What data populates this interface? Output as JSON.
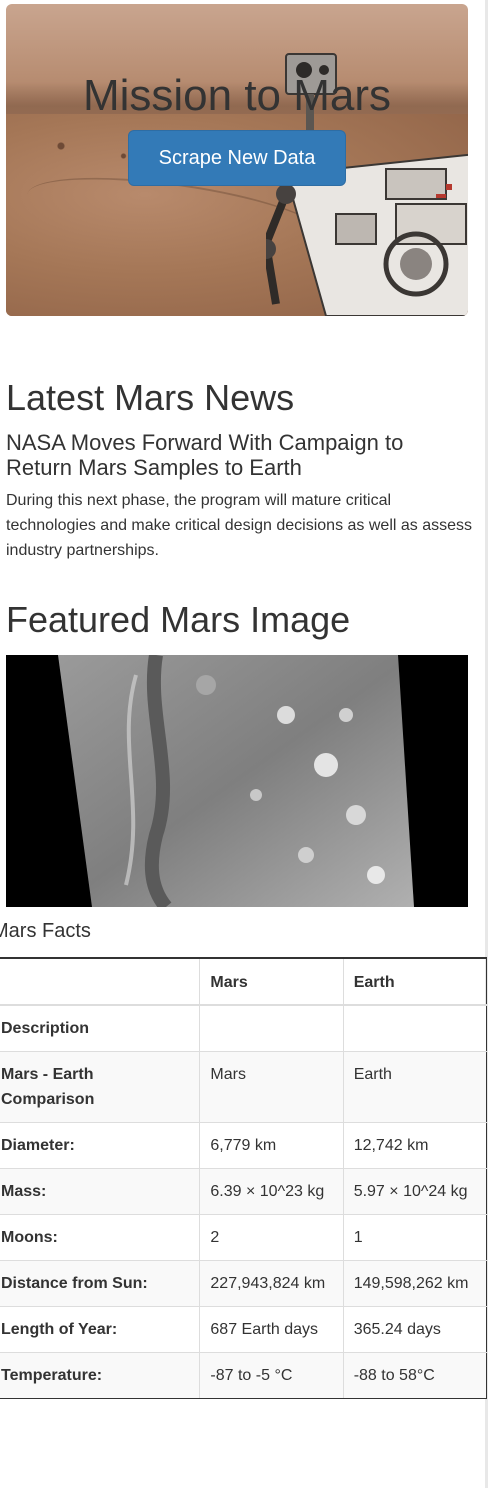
{
  "jumbotron": {
    "title": "Mission to Mars",
    "scrape_button": "Scrape New Data"
  },
  "news": {
    "heading": "Latest Mars News",
    "title": "NASA Moves Forward With Campaign to Return Mars Samples to Earth",
    "paragraph": "During this next phase, the program will mature critical technologies and make critical design decisions as well as assess industry partnerships."
  },
  "featured": {
    "heading": "Featured Mars Image"
  },
  "facts": {
    "caption": "Mars Facts",
    "headers": [
      "",
      "Mars",
      "Earth"
    ],
    "rows": [
      {
        "label": "Description",
        "mars": "",
        "earth": ""
      },
      {
        "label": "Mars - Earth Comparison",
        "mars": "Mars",
        "earth": "Earth"
      },
      {
        "label": "Diameter:",
        "mars": "6,779 km",
        "earth": "12,742 km"
      },
      {
        "label": "Mass:",
        "mars": "6.39 × 10^23 kg",
        "earth": "5.97 × 10^24 kg"
      },
      {
        "label": "Moons:",
        "mars": "2",
        "earth": "1"
      },
      {
        "label": "Distance from Sun:",
        "mars": "227,943,824 km",
        "earth": "149,598,262 km"
      },
      {
        "label": "Length of Year:",
        "mars": "687 Earth days",
        "earth": "365.24 days"
      },
      {
        "label": "Temperature:",
        "mars": "-87 to -5 °C",
        "earth": "-88 to 58°C"
      }
    ]
  }
}
